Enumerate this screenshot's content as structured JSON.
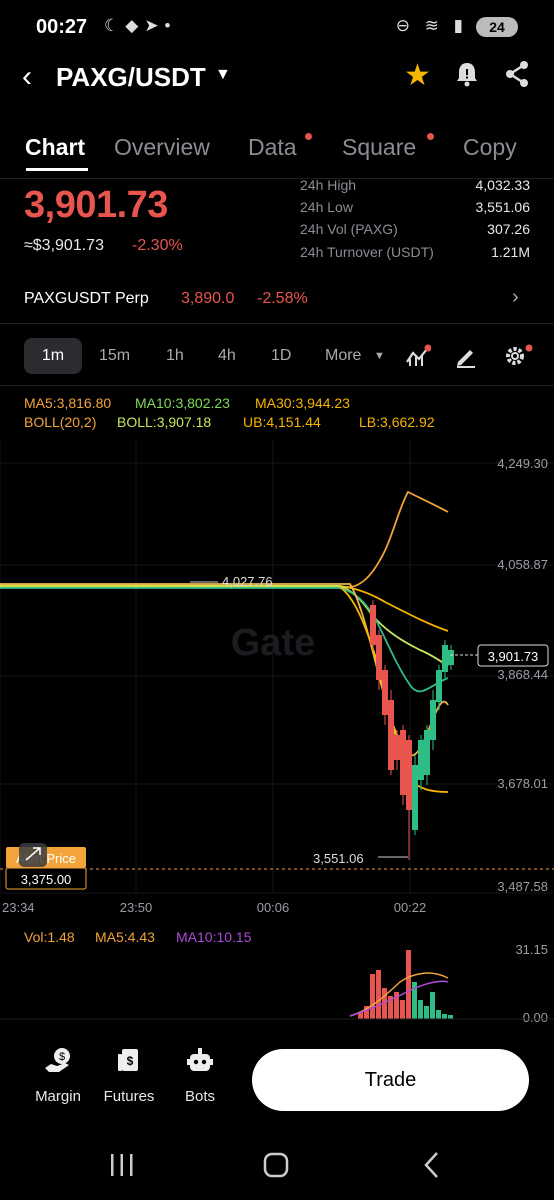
{
  "status": {
    "time": "00:27",
    "battery": "24"
  },
  "header": {
    "pair": "PAXG/USDT"
  },
  "tabs": [
    {
      "label": "Chart",
      "active": true
    },
    {
      "label": "Overview"
    },
    {
      "label": "Data",
      "dot": true
    },
    {
      "label": "Square",
      "dot": true
    },
    {
      "label": "Copy"
    }
  ],
  "ticker": {
    "price": "3,901.73",
    "usd_price": "≈$3,901.73",
    "change": "-2.30%",
    "stats": [
      {
        "label": "24h High",
        "value": "4,032.33"
      },
      {
        "label": "24h Low",
        "value": "3,551.06"
      },
      {
        "label": "24h Vol (PAXG)",
        "value": "307.26"
      },
      {
        "label": "24h Turnover (USDT)",
        "value": "1.21M"
      }
    ]
  },
  "perp": {
    "name": "PAXGUSDT Perp",
    "price": "3,890.0",
    "change": "-2.58%"
  },
  "timeframes": [
    "1m",
    "15m",
    "1h",
    "4h",
    "1D",
    "More"
  ],
  "indicators": {
    "ma5": "MA5:3,816.80",
    "ma10": "MA10:3,802.23",
    "ma30": "MA30:3,944.23",
    "boll": "BOLL(20,2)",
    "boll_mid": "BOLL:3,907.18",
    "ub": "UB:4,151.44",
    "lb": "LB:3,662.92"
  },
  "chart": {
    "axis_labels": [
      "4,249.30",
      "4,058.87",
      "3,868.44",
      "3,678.01",
      "3,487.58"
    ],
    "time_labels": [
      "23:34",
      "23:50",
      "00:06",
      "00:22"
    ],
    "current_price_tag": "3,901.73",
    "high_label": "4,027.76",
    "low_label": "3,551.06",
    "alert_label": "Alert Price",
    "alert_value": "3,375.00",
    "watermark": "Gate"
  },
  "volume": {
    "vol": "Vol:1.48",
    "ma5": "MA5:4.43",
    "ma10": "MA10:10.15",
    "axis_top": "31.15",
    "axis_bottom": "0.00"
  },
  "colors": {
    "up": "#2ebd85",
    "down": "#e8554e",
    "accent": "#f7b500"
  },
  "bottom_nav": [
    {
      "label": "Margin",
      "icon": "margin-icon"
    },
    {
      "label": "Futures",
      "icon": "futures-icon"
    },
    {
      "label": "Bots",
      "icon": "bots-icon"
    }
  ],
  "trade_button": "Trade"
}
